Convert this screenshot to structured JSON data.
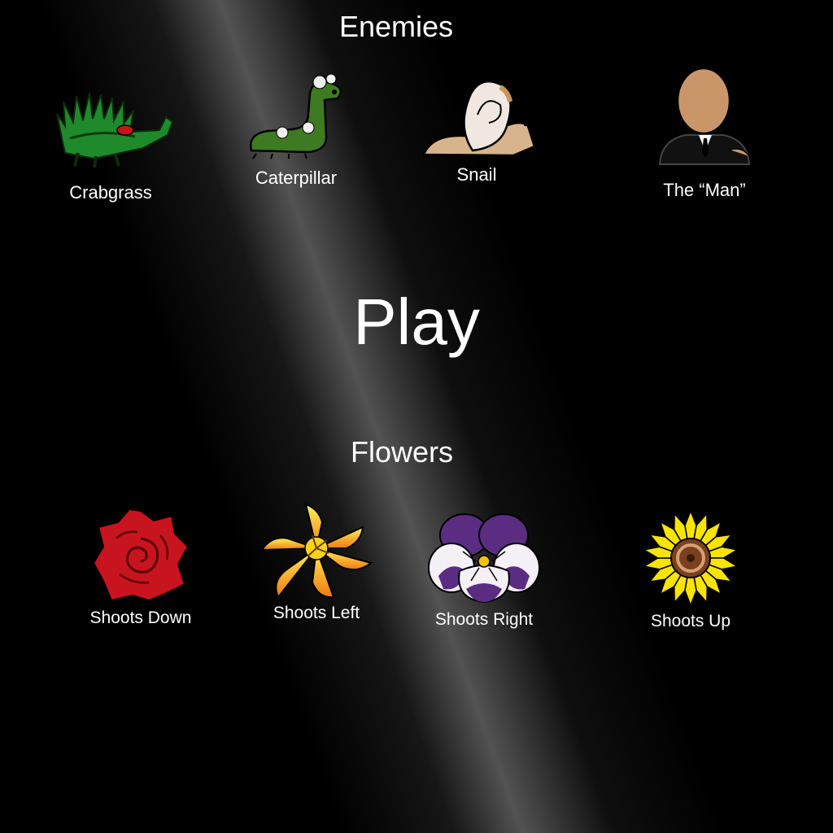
{
  "headings": {
    "enemies": "Enemies",
    "flowers": "Flowers"
  },
  "play_label": "Play",
  "enemies": [
    {
      "name": "Crabgrass",
      "icon": "crabgrass-icon"
    },
    {
      "name": "Caterpillar",
      "icon": "caterpillar-icon"
    },
    {
      "name": "Snail",
      "icon": "snail-icon"
    },
    {
      "name": "The “Man”",
      "icon": "the-man-icon"
    }
  ],
  "flowers": [
    {
      "name": "Shoots Down",
      "icon": "rose-icon",
      "color": "#c8141e"
    },
    {
      "name": "Shoots Left",
      "icon": "lily-icon",
      "color": "#f5b800"
    },
    {
      "name": "Shoots Right",
      "icon": "pansy-icon",
      "color": "#5a2d82"
    },
    {
      "name": "Shoots Up",
      "icon": "sunflower-icon",
      "color": "#f7e400"
    }
  ]
}
